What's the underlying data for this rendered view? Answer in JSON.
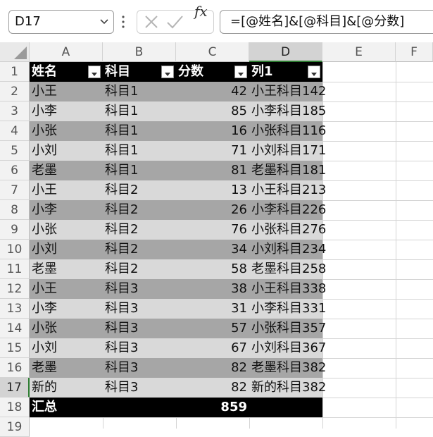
{
  "name_box": "D17",
  "formula": "=[@姓名]&[@科目]&[@分数]",
  "fx_label": "fx",
  "columns": [
    "A",
    "B",
    "C",
    "D",
    "E",
    "F"
  ],
  "header_row": {
    "row": "1",
    "a": "姓名",
    "b": "科目",
    "c": "分数",
    "d": "列1"
  },
  "rows": [
    {
      "row": "2",
      "a": "小王",
      "b": "科目1",
      "c": "42",
      "d": "小王科目142"
    },
    {
      "row": "3",
      "a": "小李",
      "b": "科目1",
      "c": "85",
      "d": "小李科目185"
    },
    {
      "row": "4",
      "a": "小张",
      "b": "科目1",
      "c": "16",
      "d": "小张科目116"
    },
    {
      "row": "5",
      "a": "小刘",
      "b": "科目1",
      "c": "71",
      "d": "小刘科目171"
    },
    {
      "row": "6",
      "a": "老墨",
      "b": "科目1",
      "c": "81",
      "d": "老墨科目181"
    },
    {
      "row": "7",
      "a": "小王",
      "b": "科目2",
      "c": "13",
      "d": "小王科目213"
    },
    {
      "row": "8",
      "a": "小李",
      "b": "科目2",
      "c": "26",
      "d": "小李科目226"
    },
    {
      "row": "9",
      "a": "小张",
      "b": "科目2",
      "c": "76",
      "d": "小张科目276"
    },
    {
      "row": "10",
      "a": "小刘",
      "b": "科目2",
      "c": "34",
      "d": "小刘科目234"
    },
    {
      "row": "11",
      "a": "老墨",
      "b": "科目2",
      "c": "58",
      "d": "老墨科目258"
    },
    {
      "row": "12",
      "a": "小王",
      "b": "科目3",
      "c": "38",
      "d": "小王科目338"
    },
    {
      "row": "13",
      "a": "小李",
      "b": "科目3",
      "c": "31",
      "d": "小李科目331"
    },
    {
      "row": "14",
      "a": "小张",
      "b": "科目3",
      "c": "57",
      "d": "小张科目357"
    },
    {
      "row": "15",
      "a": "小刘",
      "b": "科目3",
      "c": "67",
      "d": "小刘科目367"
    },
    {
      "row": "16",
      "a": "老墨",
      "b": "科目3",
      "c": "82",
      "d": "老墨科目382"
    },
    {
      "row": "17",
      "a": "新的",
      "b": "科目3",
      "c": "82",
      "d": "新的科目382"
    }
  ],
  "total_row": {
    "row": "18",
    "a": "汇总",
    "c": "859"
  },
  "empty_rows": [
    "19"
  ],
  "colors": {
    "header_bg": "#000000",
    "band_dark": "#a6a6a6",
    "band_light": "#d9d9d9",
    "selection": "#1e6e34"
  },
  "icons": {
    "cancel": "x-icon",
    "enter": "check-icon",
    "function": "fx-icon"
  }
}
